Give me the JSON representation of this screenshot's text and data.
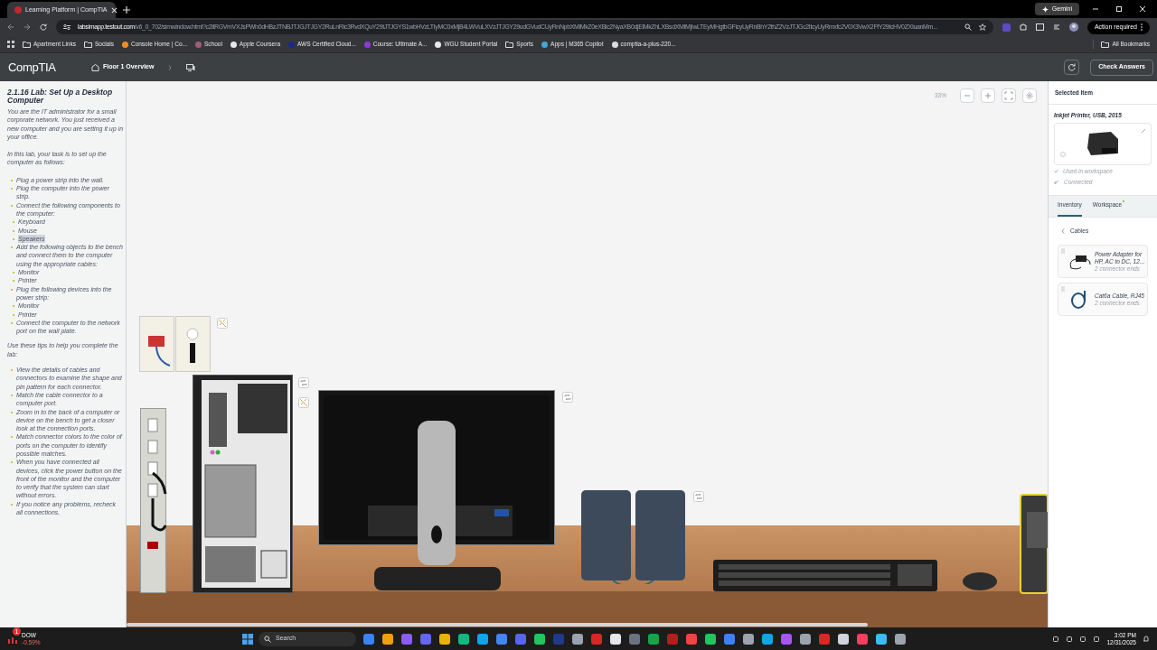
{
  "browser": {
    "tab_title": "Learning Platform | CompTIA",
    "url_host": "labsimapp.testout.com",
    "url_path": "/v6_0_702/simwindow.html?c2ltRGVmVXJsPWh0dHBzJTNBJTJGJTJGY2RuLnRlc3RvdXQuY29tJTJGYS1wbHVzLTIyMC0xMjB4LWVuLXVzJTJGY29udGVudCUyRnNpbXMlMkZ0eXBlc2NyaXB0djElMkZhLXBsdXMtMjIwLTEyMHgtbGFicyUyRnBhY2thZ2VzJTJGc2ItcyUyRmxfc2V0X3VwX2FfY29tcHV0ZXIuanMm...",
    "gemini": "Gemini",
    "action": "Action required",
    "bookmarks": [
      {
        "label": "Apartment Links",
        "kind": "folder"
      },
      {
        "label": "Socials",
        "kind": "folder"
      },
      {
        "label": "Console Home | Co...",
        "kind": "site",
        "color": "#f28b25"
      },
      {
        "label": "School",
        "kind": "site",
        "color": "#a05c7b"
      },
      {
        "label": "Apple Coursera",
        "kind": "site",
        "color": "#e8e8e8"
      },
      {
        "label": "AWS Certified Cloud...",
        "kind": "site",
        "color": "#1b2a8a"
      },
      {
        "label": "Course: Ultimate A...",
        "kind": "site",
        "color": "#8a3ad8"
      },
      {
        "label": "WGU Student Portal",
        "kind": "site",
        "color": "#e8e8f0"
      },
      {
        "label": "Sports",
        "kind": "folder"
      },
      {
        "label": "Apps | M365 Copilot",
        "kind": "site",
        "color": "#3fa9d9"
      },
      {
        "label": "comptia-a-plus-220...",
        "kind": "site",
        "color": "#dddddd"
      }
    ],
    "all_bookmarks": "All Bookmarks"
  },
  "app": {
    "logo": "CompTIA",
    "breadcrumb": "Floor 1 Overview",
    "check_button": "Check Answers"
  },
  "instructions": {
    "title": "2.1.16 Lab: Set Up a Desktop Computer",
    "intro": [
      "You are the IT administrator for a small corporate network. You just received a new computer and you are setting it up in your office.",
      "In this lab, your task is to set up the computer as follows:"
    ],
    "tasks": [
      {
        "text": "Plug a power strip into the wall."
      },
      {
        "text": "Plug the computer into the power strip."
      },
      {
        "text": "Connect the following components to the computer:",
        "children": [
          {
            "text": "Keyboard",
            "highlighted": false
          },
          {
            "text": "Mouse",
            "highlighted": false
          },
          {
            "text": "Speakers",
            "highlighted": true
          }
        ]
      },
      {
        "text": "Add the following objects to the bench and connect them to the computer using the appropriate cables:",
        "children": [
          {
            "text": "Monitor",
            "highlighted": false
          },
          {
            "text": "Printer",
            "highlighted": false
          }
        ]
      },
      {
        "text": "Plug the following devices into the power strip:",
        "children": [
          {
            "text": "Monitor",
            "highlighted": false
          },
          {
            "text": "Printer",
            "highlighted": false
          }
        ]
      },
      {
        "text": "Connect the computer to the network port on the wall plate."
      }
    ],
    "tips_intro": "Use these tips to help you complete the lab:",
    "tips": [
      "View the details of cables and connectors to examine the shape and pin pattern for each connector.",
      "Match the cable connector to a computer port.",
      "Zoom in to the back of a computer or device on the bench to get a closer look at the connection ports.",
      "Match connector colors to the color of ports on the computer to identify possible matches.",
      "When you have connected all devices, click the power button on the front of the monitor and the computer to verify that the system can start without errors.",
      "If you notice any problems, recheck all connections."
    ]
  },
  "canvas": {
    "zoom": "33%"
  },
  "selected_item": {
    "heading": "Selected Item",
    "name": "Inkjet Printer, USB, 2015",
    "statuses": [
      {
        "kind": "used",
        "text": "Used in workspace"
      },
      {
        "kind": "connected",
        "text": "Connected"
      }
    ]
  },
  "tabs": [
    {
      "label": "Inventory",
      "selected": true,
      "dot": false
    },
    {
      "label": "Workspace",
      "selected": false,
      "dot": true
    }
  ],
  "inventory": {
    "category": "Cables",
    "items": [
      {
        "kind": "adapter",
        "name": "Power Adapter for HP, AC to DC, 12...",
        "detail": "2 connector ends"
      },
      {
        "kind": "network",
        "name": "Cat6a Cable, RJ45",
        "detail": "2 connector ends"
      }
    ]
  },
  "taskbar": {
    "ticker": "DOW",
    "change": "-0.59%",
    "badge": "1",
    "search": "Search",
    "time": "3:02 PM",
    "date": "12/31/2025"
  }
}
